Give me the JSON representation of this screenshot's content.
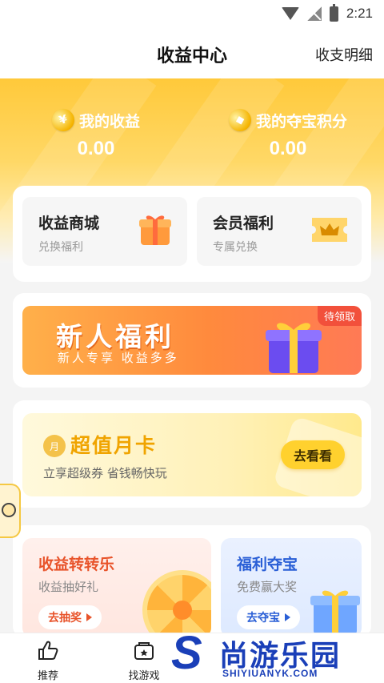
{
  "status_bar": {
    "time": "2:21"
  },
  "header": {
    "title": "收益中心",
    "link_label": "收支明细"
  },
  "stats": [
    {
      "label": "我的收益",
      "value": "0.00",
      "icon": "coin-icon"
    },
    {
      "label": "我的夺宝积分",
      "value": "0.00",
      "icon": "coin-icon"
    }
  ],
  "quick_links": [
    {
      "title": "收益商城",
      "subtitle": "兑换福利",
      "icon": "gift-icon"
    },
    {
      "title": "会员福利",
      "subtitle": "专属兑换",
      "icon": "crown-ticket-icon"
    }
  ],
  "newbie": {
    "title": "新人福利",
    "subtitle": "新人专享 收益多多",
    "badge": "待领取"
  },
  "monthly_card": {
    "icon_text": "月",
    "title": "超值月卡",
    "subtitle": "立享超级券 省钱畅快玩",
    "button": "去看看"
  },
  "games": [
    {
      "title": "收益转转乐",
      "subtitle": "收益抽好礼",
      "button": "去抽奖",
      "color": "#e8532a"
    },
    {
      "title": "福利夺宝",
      "subtitle": "免费赢大奖",
      "button": "去夺宝",
      "color": "#2a5fd6"
    }
  ],
  "bottom_nav": [
    {
      "label": "推荐",
      "icon": "thumbs-up-icon"
    },
    {
      "label": "找游戏",
      "icon": "game-box-icon"
    }
  ],
  "watermark": {
    "mark": "S",
    "text": "尚游乐园",
    "url": "SHIYIUANYK.COM"
  }
}
